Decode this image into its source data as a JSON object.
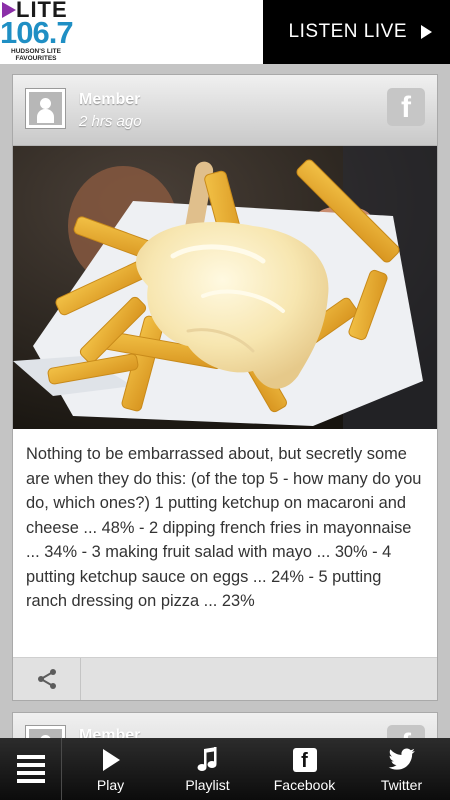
{
  "header": {
    "logo": {
      "name": "LITE",
      "frequency": "106.7",
      "tagline": "HUDSON'S LITE FAVOURITES"
    },
    "listen_live_label": "LISTEN LIVE"
  },
  "post": {
    "author": "Member",
    "time_ago": "2 hrs ago",
    "image_alt": "Plate of french fries topped with mayonnaise",
    "text": "Nothing to be embarrassed about, but secretly some are when they do this: (of the top 5 - how many do you do, which ones?) 1 putting ketchup on macaroni and cheese ... 48% - 2 dipping french fries in mayonnaise ... 34% - 3 making fruit salad with mayo ... 30% - 4 putting ketchup sauce on eggs ... 24% - 5 putting ranch dressing on pizza ... 23%",
    "source_icon": "facebook-icon"
  },
  "next_post": {
    "author": "Member"
  },
  "bottom_nav": {
    "items": [
      {
        "label": "Play",
        "icon": "play-icon"
      },
      {
        "label": "Playlist",
        "icon": "music-note-icon"
      },
      {
        "label": "Facebook",
        "icon": "facebook-icon"
      },
      {
        "label": "Twitter",
        "icon": "twitter-bird-icon"
      }
    ]
  },
  "colors": {
    "brand_blue": "#1f8fc4",
    "brand_purple": "#8b2fa8",
    "header_dark": "#000000",
    "nav_bg": "#1c1c1c"
  }
}
